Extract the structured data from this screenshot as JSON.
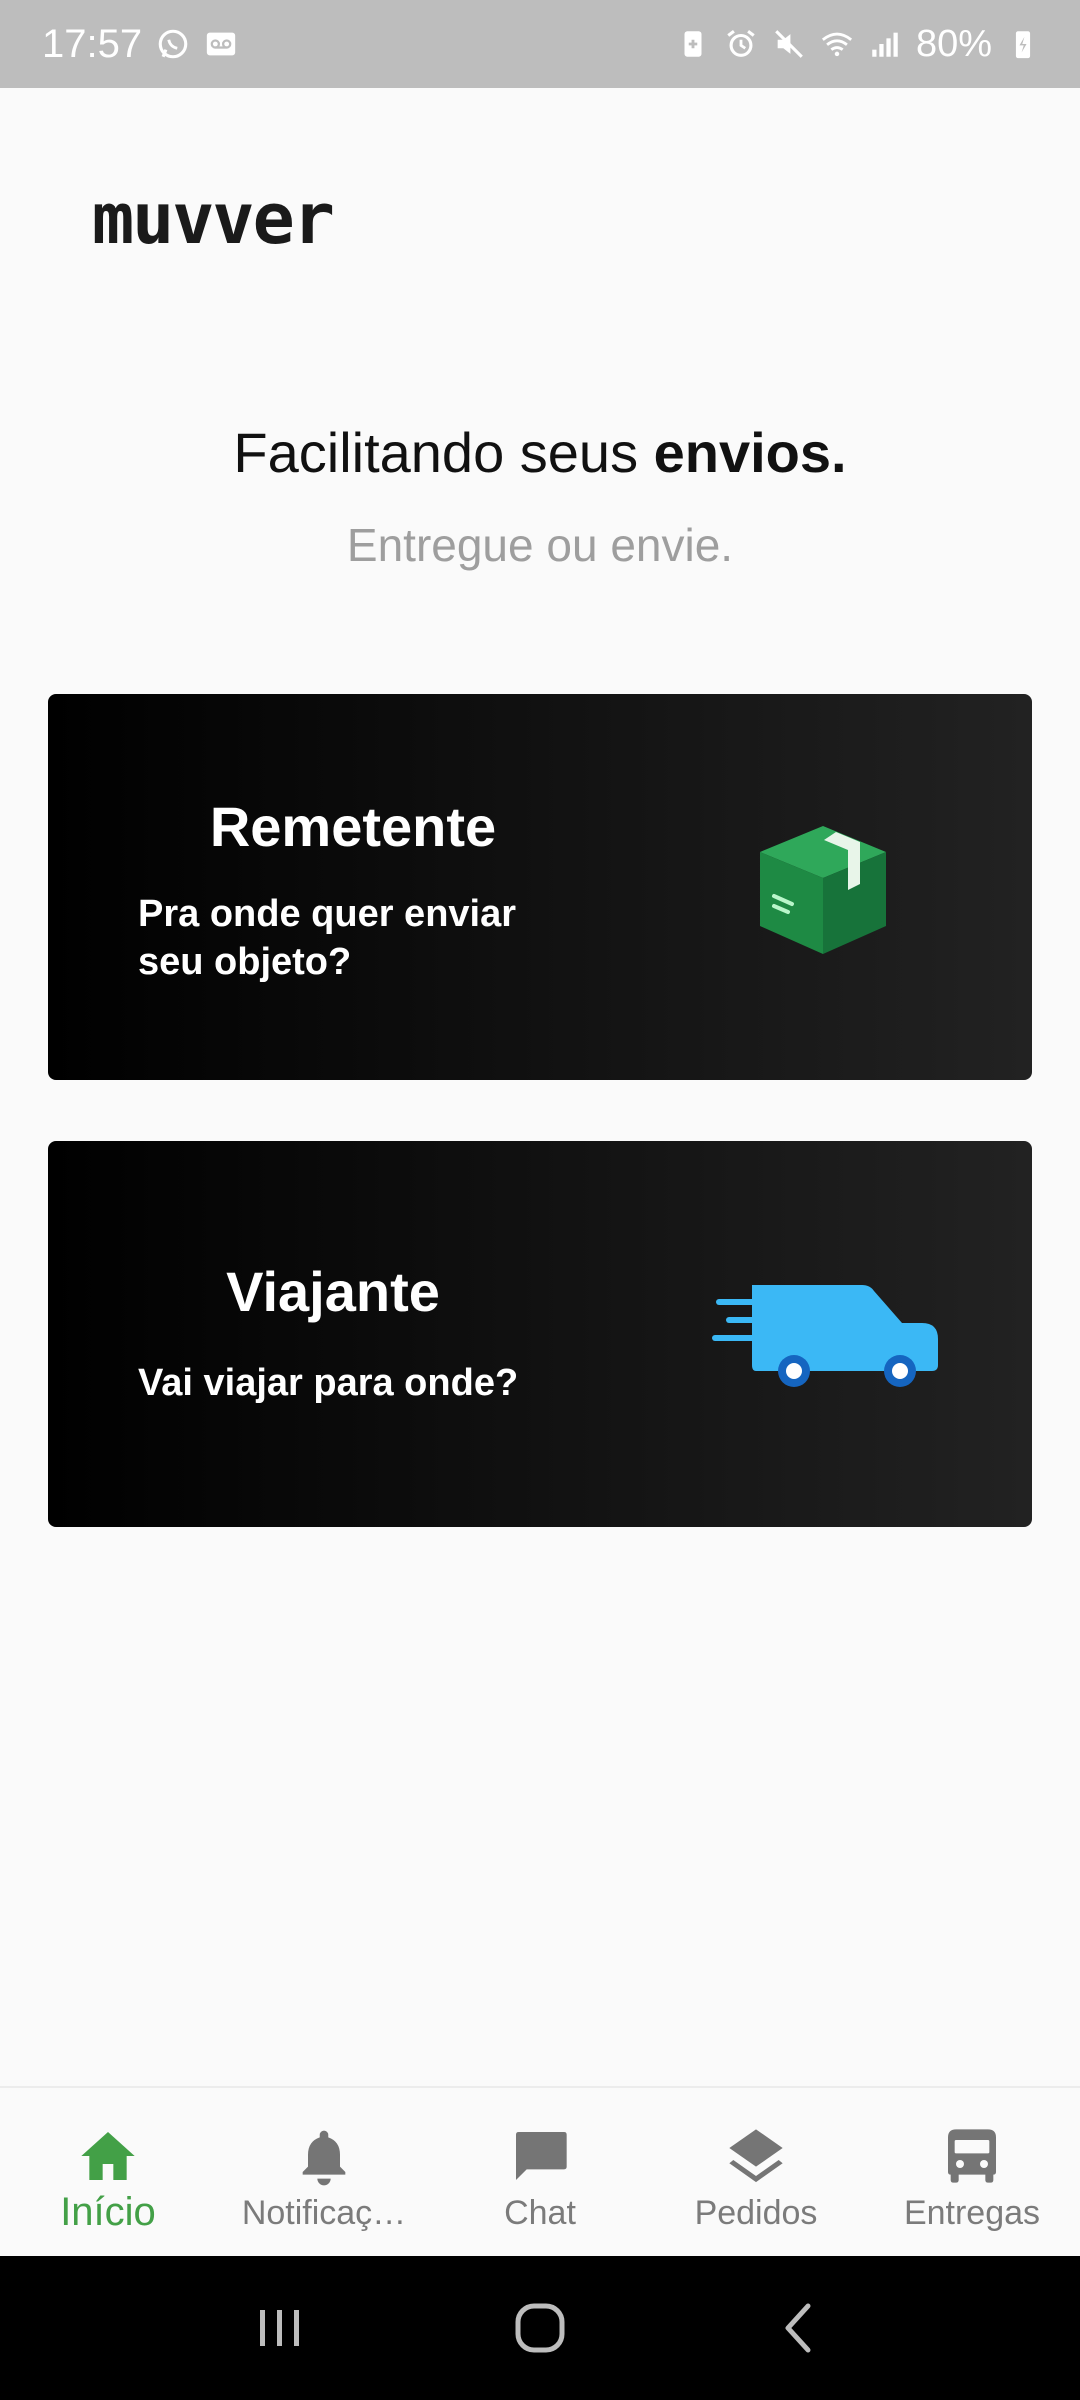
{
  "status_bar": {
    "time": "17:57",
    "battery": "80%",
    "left_icons": [
      "whatsapp-icon",
      "voicemail-icon"
    ],
    "right_icons": [
      "battery-saver-icon",
      "alarm-icon",
      "mute-icon",
      "wifi-icon",
      "signal-icon",
      "battery-charging-icon"
    ]
  },
  "app": {
    "logo": "muvver",
    "headline_regular": "Facilitando seus ",
    "headline_bold": "envios.",
    "subheadline": "Entregue ou envie."
  },
  "cards": {
    "sender": {
      "title": "Remetente",
      "subtitle_line1": "Pra onde quer enviar",
      "subtitle_line2": "seu objeto?",
      "icon": "package-icon",
      "icon_color": "#1e8a44"
    },
    "traveler": {
      "title": "Viajante",
      "subtitle": "Vai viajar para onde?",
      "icon": "delivery-truck-icon",
      "icon_color": "#3bb8f5"
    }
  },
  "bottom_nav": {
    "active_color": "#43a047",
    "inactive_color": "#7b7b7b",
    "items": [
      {
        "label": "Início",
        "icon": "home-icon",
        "active": true
      },
      {
        "label": "Notificaç…",
        "icon": "bell-icon",
        "active": false
      },
      {
        "label": "Chat",
        "icon": "chat-icon",
        "active": false
      },
      {
        "label": "Pedidos",
        "icon": "layers-icon",
        "active": false
      },
      {
        "label": "Entregas",
        "icon": "bus-icon",
        "active": false
      }
    ]
  },
  "system_nav": {
    "buttons": [
      "recent-apps-icon",
      "home-button-icon",
      "back-icon"
    ]
  }
}
